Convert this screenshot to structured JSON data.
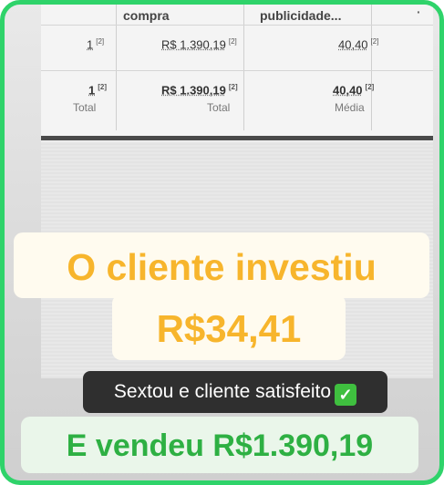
{
  "table": {
    "headers": [
      "compra",
      "publicidade..."
    ],
    "header_dot": "·",
    "rows": [
      {
        "col1": "1",
        "col1_sup": "[2]",
        "col2": "R$ 1.390,19",
        "col2_sup": "[2]",
        "col3": "40,40",
        "col3_sup": "[2]"
      },
      {
        "col1": "1",
        "col1_sup": "[2]",
        "col2": "R$ 1.390,19",
        "col2_sup": "[2]",
        "col3": "40,40",
        "col3_sup": "[2]"
      }
    ],
    "totals_labels": [
      "Total",
      "Total",
      "Média"
    ]
  },
  "captions": {
    "line1": "O cliente investiu",
    "line2": "R$34,41",
    "line3": "Sextou e cliente satisfeito",
    "line3_icon": "✓",
    "line4": "E vendeu R$1.390,19"
  },
  "colors": {
    "frame": "#2fd36a",
    "caption_orange": "#f7b52c",
    "caption_green": "#2eb043"
  },
  "icons": {
    "check": "check-mark-icon"
  }
}
